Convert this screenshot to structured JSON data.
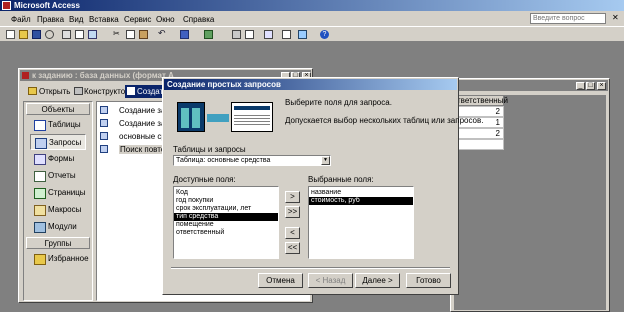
{
  "app": {
    "title": "Microsoft Access",
    "help_placeholder": "Введите вопрос"
  },
  "menu": [
    "Файл",
    "Правка",
    "Вид",
    "Вставка",
    "Сервис",
    "Окно",
    "Справка"
  ],
  "db_window": {
    "title": "к заданию : база данных (формат А",
    "toolbar": {
      "open": "Открыть",
      "design": "Конструктор",
      "create": "Создать"
    },
    "objects_header": "Объекты",
    "objects": [
      "Таблицы",
      "Запросы",
      "Формы",
      "Отчеты",
      "Страницы",
      "Макросы",
      "Модули"
    ],
    "groups_header": "Группы",
    "groups": [
      "Избранное"
    ],
    "items": [
      "Создание запр",
      "Создание запр",
      "основные средс",
      "Поиск повторе"
    ]
  },
  "bg_table": {
    "header": "тветственный",
    "values": [
      "2",
      "1",
      "2"
    ]
  },
  "wizard": {
    "title": "Создание простых запросов",
    "prompt": "Выберите поля для запроса.",
    "hint": "Допускается выбор нескольких таблиц или запросов.",
    "source_label": "Таблицы и запросы",
    "source_value": "Таблица: основные средства",
    "available_label": "Доступные поля:",
    "available_fields": [
      "Код",
      "год покупки",
      "срок эксплуатации, лет",
      "тип средства",
      "помещение",
      "ответственный"
    ],
    "available_selected": "тип средства",
    "selected_label": "Выбранные поля:",
    "selected_fields": [
      "название",
      "стоимость, руб"
    ],
    "selected_selected": "стоимость, руб",
    "move_buttons": [
      ">",
      ">>",
      "<",
      "<<"
    ],
    "buttons": {
      "cancel": "Отмена",
      "back": "< Назад",
      "next": "Далее >",
      "finish": "Готово"
    }
  },
  "colors": {
    "title_active": "#0a246a",
    "title_gradient": "#a6caf0",
    "title_inactive": "#808080",
    "face": "#d4d0c8"
  }
}
